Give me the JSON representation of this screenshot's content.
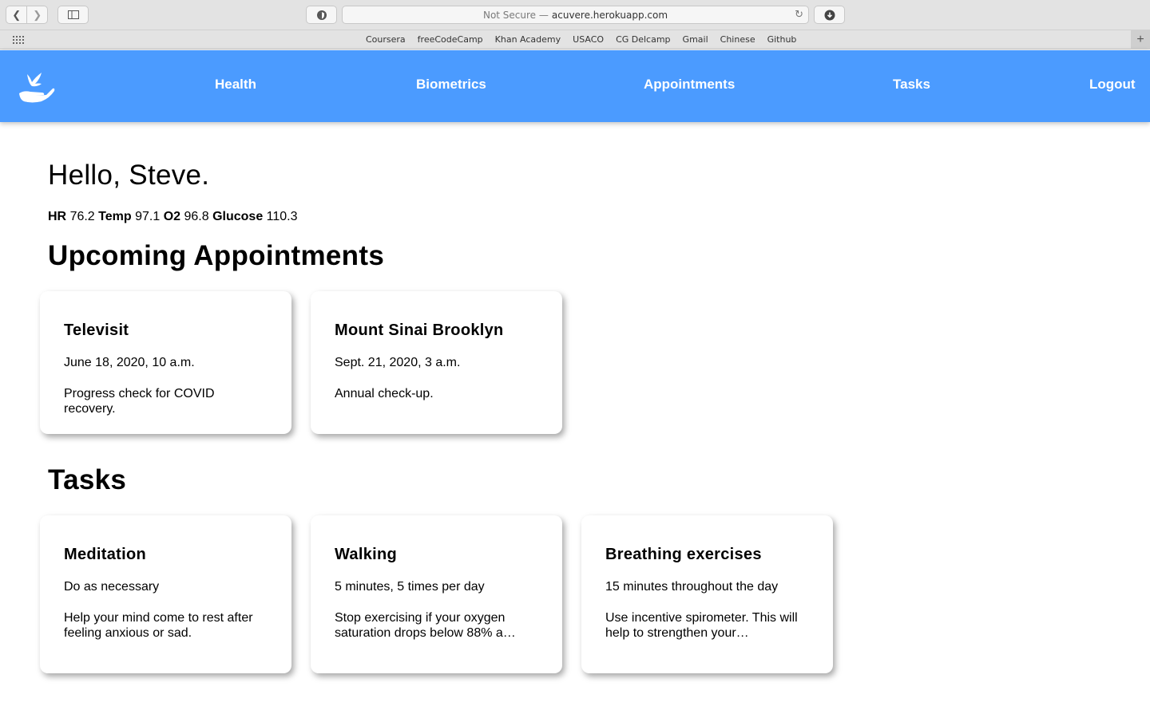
{
  "browser": {
    "url_prefix": "Not Secure —",
    "url": "acuvere.herokuapp.com",
    "bookmarks": [
      "Coursera",
      "freeCodeCamp",
      "Khan Academy",
      "USACO",
      "CG Delcamp",
      "Gmail",
      "Chinese",
      "Github"
    ]
  },
  "nav": {
    "health": "Health",
    "biometrics": "Biometrics",
    "appointments": "Appointments",
    "tasks": "Tasks",
    "logout": "Logout"
  },
  "greeting": "Hello, Steve.",
  "vitals": [
    {
      "label": "HR",
      "value": "76.2"
    },
    {
      "label": "Temp",
      "value": "97.1"
    },
    {
      "label": "O2",
      "value": "96.8"
    },
    {
      "label": "Glucose",
      "value": "110.3"
    }
  ],
  "appointments": {
    "title": "Upcoming Appointments",
    "items": [
      {
        "title": "Televisit",
        "when": "June 18, 2020, 10 a.m.",
        "desc": "Progress check for COVID recovery."
      },
      {
        "title": "Mount Sinai Brooklyn",
        "when": "Sept. 21, 2020, 3 a.m.",
        "desc": "Annual check-up."
      }
    ]
  },
  "tasks": {
    "title": "Tasks",
    "items": [
      {
        "title": "Meditation",
        "freq": "Do as necessary",
        "desc": "Help your mind come to rest after feeling anxious or sad."
      },
      {
        "title": "Walking",
        "freq": "5 minutes, 5 times per day",
        "desc": "Stop exercising if your oxygen saturation drops below 88% a…"
      },
      {
        "title": "Breathing exercises",
        "freq": "15 minutes throughout the day",
        "desc": "Use incentive spirometer. This will help to strengthen your…"
      }
    ]
  },
  "colors": {
    "header": "#4b9bff"
  }
}
